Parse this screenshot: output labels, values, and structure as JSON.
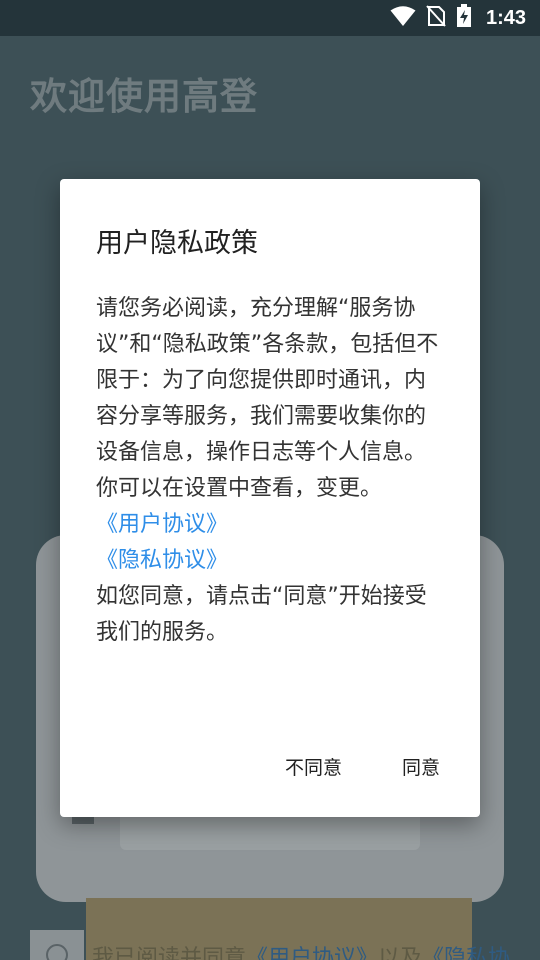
{
  "status_bar": {
    "time": "1:43",
    "icons": [
      "wifi-icon",
      "no-sim-icon",
      "battery-charging-icon"
    ]
  },
  "background": {
    "title": "欢迎使用高登",
    "footer_text_prefix": "我已阅读并同意",
    "footer_link_user": "《用户协议》",
    "footer_text_and": "以及",
    "footer_link_privacy": "《隐私协"
  },
  "dialog": {
    "title": "用户隐私政策",
    "body_text": "请您务必阅读，充分理解“服务协议”和“隐私政策”各条款，包括但不限于：为了向您提供即时通讯，内容分享等服务，我们需要收集你的设备信息，操作日志等个人信息。你可以在设置中查看，变更。",
    "link_user_agreement": "《用户协议》",
    "link_privacy_agreement": "《隐私协议》",
    "closing_text": "如您同意，请点击“同意”开始接受我们的服务。",
    "disagree_label": "不同意",
    "agree_label": "同意"
  },
  "colors": {
    "overlay_background": "#3d5056",
    "status_bar": "#24343a",
    "link": "#2f8ee8"
  }
}
